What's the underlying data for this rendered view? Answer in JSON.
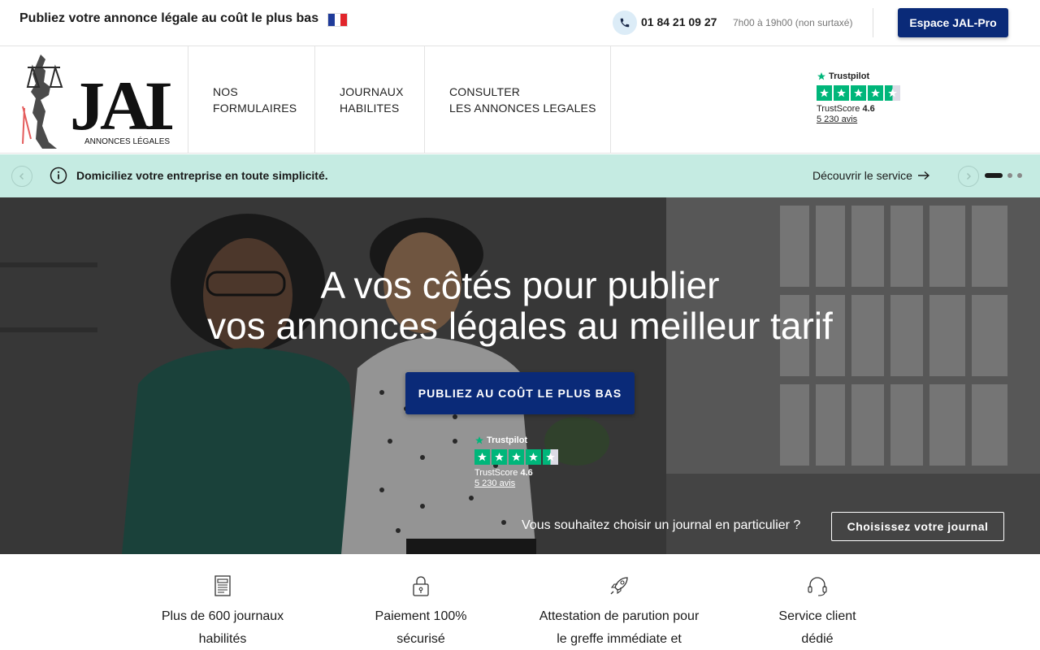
{
  "topbar": {
    "tagline": "Publiez votre annonce légale au coût le plus bas",
    "flag_colors": [
      "#1f3b9a",
      "#ffffff",
      "#e1252b"
    ],
    "phone_icon": "phone-icon",
    "phone_number": "01 84 21 09 27",
    "phone_hours": "7h00 à 19h00 (non surtaxé)",
    "pro_button": "Espace JAL-Pro"
  },
  "nav": {
    "logo_text": "JAL",
    "logo_subtext": "ANNONCES LÉGALES",
    "items": [
      {
        "label": "NOS\nFORMULAIRES"
      },
      {
        "label": "JOURNAUX\nHABILITES"
      },
      {
        "label": "CONSULTER\nLES ANNONCES LEGALES"
      }
    ]
  },
  "trustpilot": {
    "brand": "Trustpilot",
    "score_label": "TrustScore",
    "score": "4.6",
    "reviews": "5 230 avis",
    "stars": 4.5,
    "star_color": "#00b67a"
  },
  "announcement": {
    "icon": "info-icon",
    "text": "Domiciliez votre entreprise en toute simplicité.",
    "link": "Découvrir le service",
    "slide_count": 3,
    "active_slide": 1
  },
  "hero": {
    "title_line1": "A vos côtés pour publier",
    "title_line2": "vos annonces légales au meilleur tarif",
    "cta": "PUBLIEZ AU COÛT LE PLUS BAS",
    "question": "Vous souhaitez choisir un journal en particulier ?",
    "choose_button": "Choisissez votre journal"
  },
  "features": [
    {
      "icon": "newspaper-icon",
      "line1": "Plus de 600 journaux",
      "line2": "habilités"
    },
    {
      "icon": "lock-icon",
      "line1": "Paiement 100%",
      "line2": "sécurisé"
    },
    {
      "icon": "rocket-icon",
      "line1": "Attestation de parution pour",
      "line2": "le greffe immédiate et"
    },
    {
      "icon": "headset-icon",
      "line1": "Service client",
      "line2": "dédié"
    }
  ],
  "colors": {
    "brand_navy": "#0a2a78",
    "announce_bg": "#c5ebe2",
    "trustpilot_green": "#00b67a"
  }
}
